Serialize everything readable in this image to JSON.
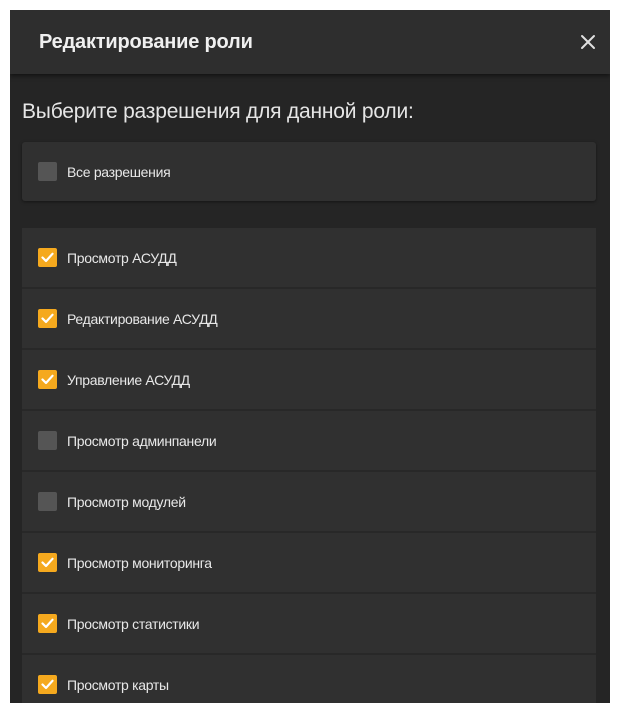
{
  "dialog": {
    "title": "Редактирование роли",
    "close_icon": "close-icon"
  },
  "subtitle": "Выберите разрешения для данной роли:",
  "all_permissions": {
    "label": "Все разрешения",
    "checked": false
  },
  "permissions": [
    {
      "label": "Просмотр АСУДД",
      "checked": true
    },
    {
      "label": "Редактирование АСУДД",
      "checked": true
    },
    {
      "label": "Управление АСУДД",
      "checked": true
    },
    {
      "label": "Просмотр админпанели",
      "checked": false
    },
    {
      "label": "Просмотр модулей",
      "checked": false
    },
    {
      "label": "Просмотр мониторинга",
      "checked": true
    },
    {
      "label": "Просмотр статистики",
      "checked": true
    },
    {
      "label": "Просмотр карты",
      "checked": true
    }
  ],
  "colors": {
    "checked": "#f5a91e",
    "unchecked": "#555555",
    "background": "#252525"
  }
}
